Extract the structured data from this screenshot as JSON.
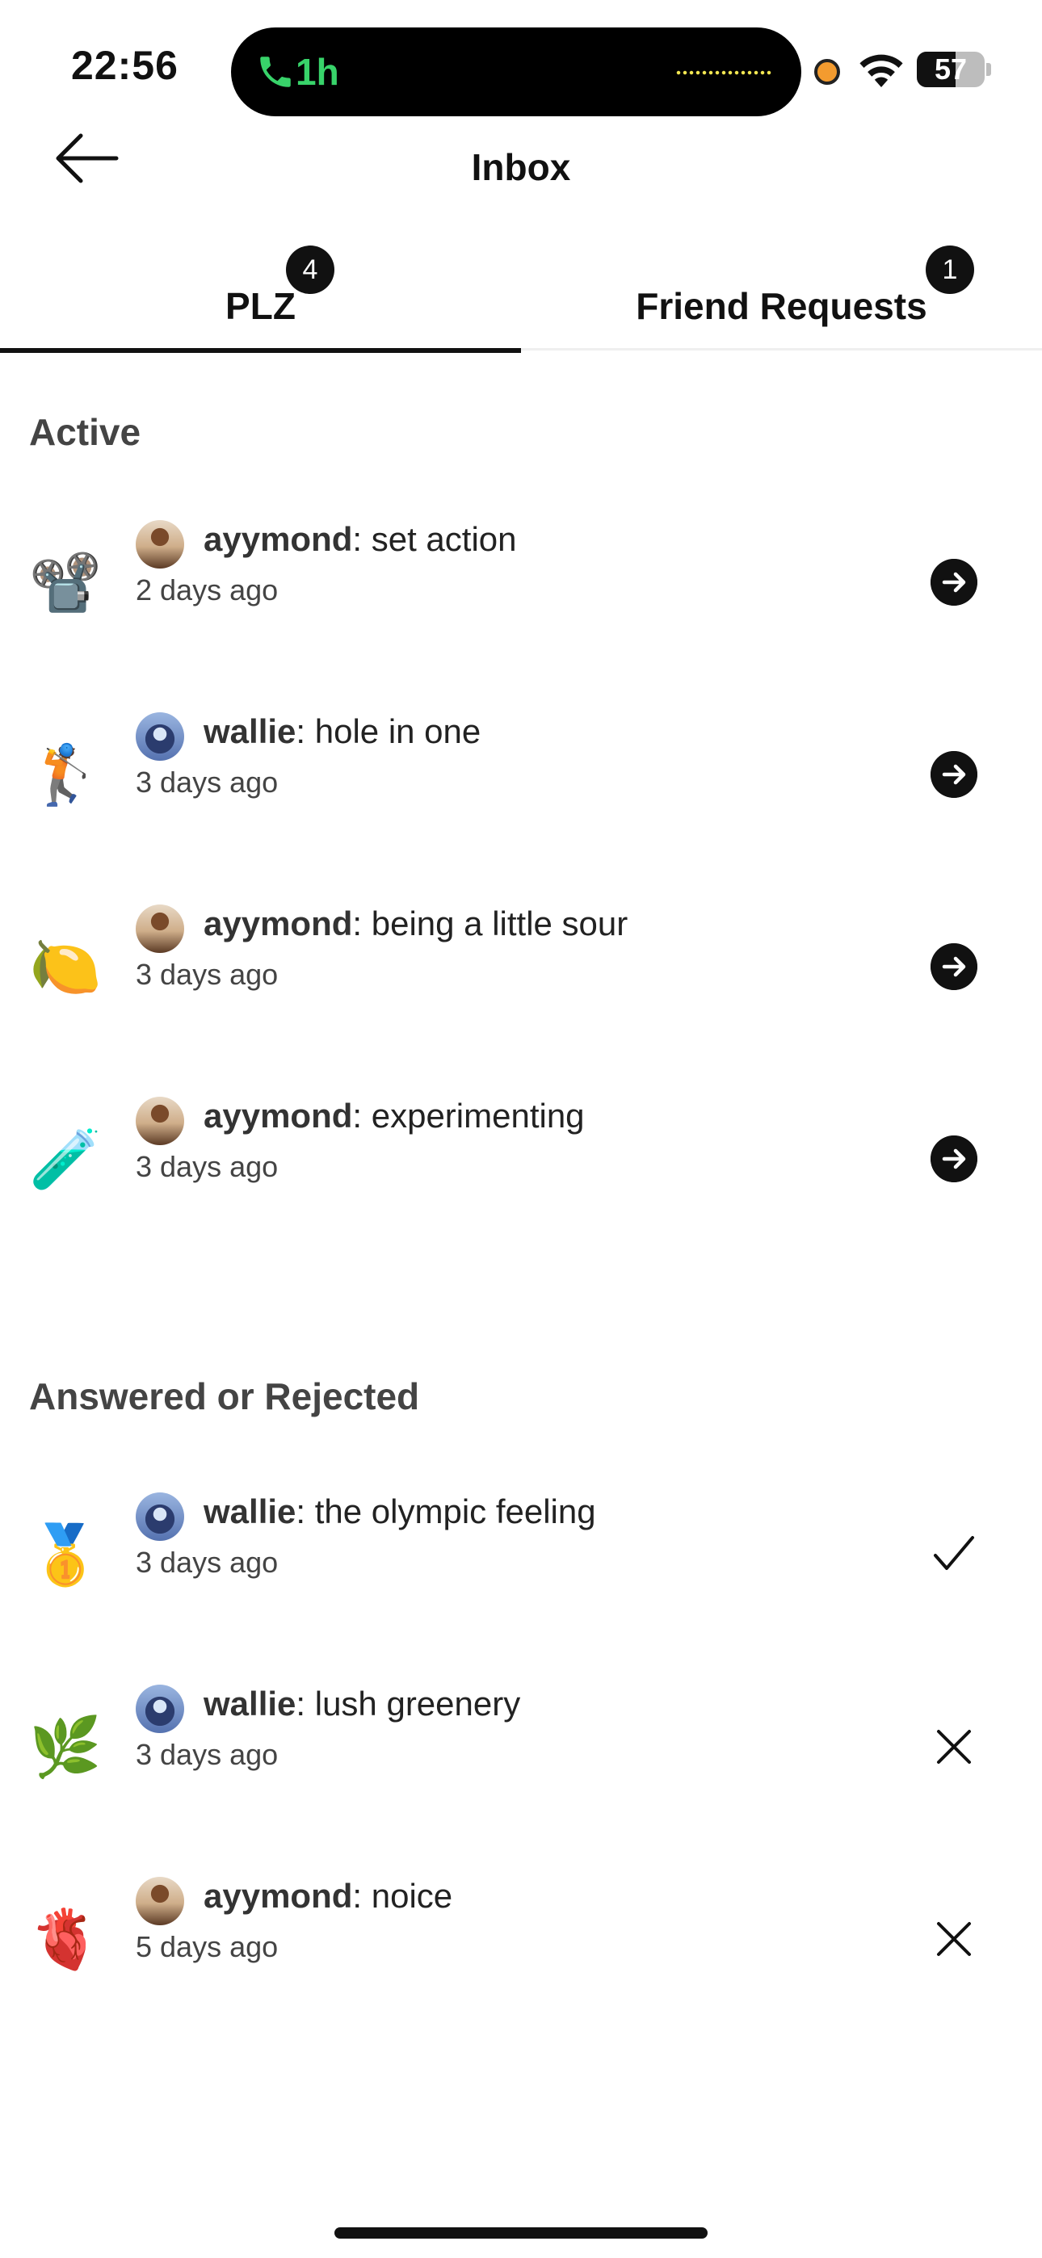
{
  "status_bar": {
    "time": "22:56",
    "call_duration": "1h",
    "battery_level": "57",
    "battery_fraction": 0.57,
    "call_color": "#38d36a"
  },
  "header": {
    "title": "Inbox",
    "back_icon": "arrow-left-icon"
  },
  "tabs": [
    {
      "label": "PLZ",
      "badge": "4",
      "active": true
    },
    {
      "label": "Friend Requests",
      "badge": "1",
      "active": false
    }
  ],
  "sections": {
    "active_heading": "Active",
    "answered_heading": "Answered or Rejected"
  },
  "active_items": [
    {
      "emoji": "📽️",
      "user": "ayymond",
      "message": ": set action",
      "time": "2 days ago",
      "action": "arrow-right-icon"
    },
    {
      "emoji": "🏌️",
      "user": "wallie",
      "message": ": hole in one",
      "time": "3 days ago",
      "action": "arrow-right-icon"
    },
    {
      "emoji": "🍋",
      "user": "ayymond",
      "message": ": being a little sour",
      "time": "3 days ago",
      "action": "arrow-right-icon"
    },
    {
      "emoji": "🧪",
      "user": "ayymond",
      "message": ": experimenting",
      "time": "3 days ago",
      "action": "arrow-right-icon"
    }
  ],
  "answered_items": [
    {
      "emoji": "🥇",
      "user": "wallie",
      "message": ": the olympic feeling",
      "time": "3 days ago",
      "status": "check-icon"
    },
    {
      "emoji": "🌿",
      "user": "wallie",
      "message": ": lush greenery",
      "time": "3 days ago",
      "status": "close-icon"
    },
    {
      "emoji": "🫀",
      "user": "ayymond",
      "message": ": noice",
      "time": "5 days ago",
      "status": "close-icon"
    }
  ]
}
